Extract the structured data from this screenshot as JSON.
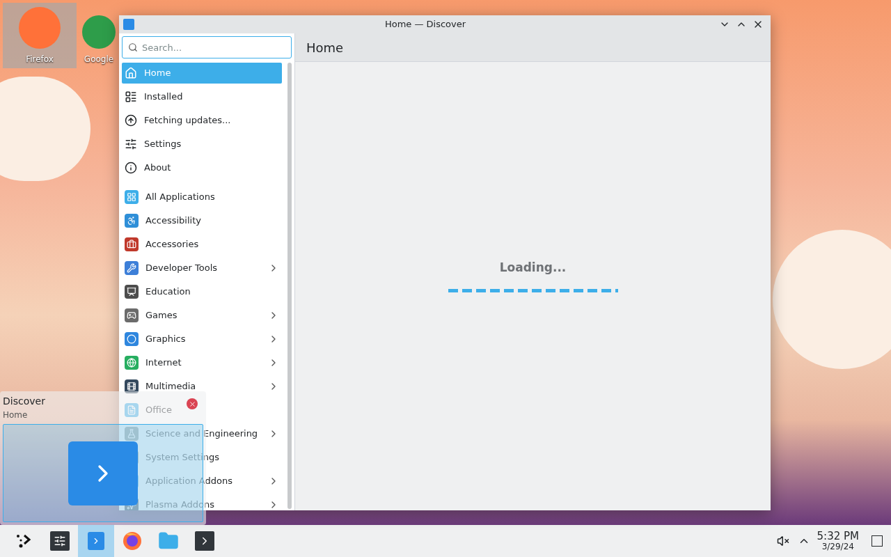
{
  "desktop_icons": [
    {
      "label": "Firefox",
      "selected": true
    },
    {
      "label": "Google",
      "selected": false
    }
  ],
  "window": {
    "title": "Home — Discover",
    "search": {
      "placeholder": "Search..."
    },
    "page_title": "Home",
    "loading_text": "Loading...",
    "sidebar": [
      {
        "kind": "nav",
        "label": "Home",
        "selected": true,
        "has_children": false
      },
      {
        "kind": "nav",
        "label": "Installed",
        "selected": false,
        "has_children": false
      },
      {
        "kind": "nav",
        "label": "Fetching updates...",
        "selected": false,
        "has_children": false
      },
      {
        "kind": "nav",
        "label": "Settings",
        "selected": false,
        "has_children": false
      },
      {
        "kind": "nav",
        "label": "About",
        "selected": false,
        "has_children": false
      },
      {
        "kind": "divider"
      },
      {
        "kind": "category",
        "label": "All Applications",
        "selected": false,
        "has_children": false
      },
      {
        "kind": "category",
        "label": "Accessibility",
        "selected": false,
        "has_children": false
      },
      {
        "kind": "category",
        "label": "Accessories",
        "selected": false,
        "has_children": false
      },
      {
        "kind": "category",
        "label": "Developer Tools",
        "selected": false,
        "has_children": true
      },
      {
        "kind": "category",
        "label": "Education",
        "selected": false,
        "has_children": false
      },
      {
        "kind": "category",
        "label": "Games",
        "selected": false,
        "has_children": true
      },
      {
        "kind": "category",
        "label": "Graphics",
        "selected": false,
        "has_children": true
      },
      {
        "kind": "category",
        "label": "Internet",
        "selected": false,
        "has_children": true
      },
      {
        "kind": "category",
        "label": "Multimedia",
        "selected": false,
        "has_children": true
      },
      {
        "kind": "category",
        "label": "Office",
        "selected": false,
        "has_children": false
      },
      {
        "kind": "category",
        "label": "Science and Engineering",
        "selected": false,
        "has_children": true
      },
      {
        "kind": "category",
        "label": "System Settings",
        "selected": false,
        "has_children": false
      },
      {
        "kind": "category",
        "label": "Application Addons",
        "selected": false,
        "has_children": true
      },
      {
        "kind": "category",
        "label": "Plasma Addons",
        "selected": false,
        "has_children": true
      }
    ]
  },
  "tooltip": {
    "title": "Discover",
    "subtitle": "Home"
  },
  "taskbar": {
    "items": [
      {
        "selected": false
      },
      {
        "selected": false
      },
      {
        "selected": true
      },
      {
        "selected": false
      },
      {
        "selected": false
      },
      {
        "selected": false
      }
    ],
    "time": "5:32 PM",
    "date": "3/29/24"
  }
}
